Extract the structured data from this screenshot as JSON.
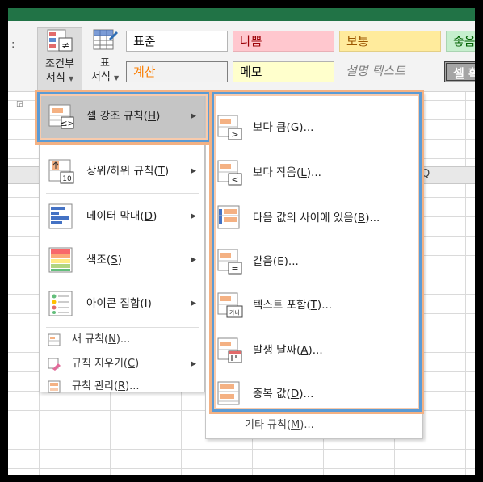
{
  "ribbon": {
    "left_fragment": ":",
    "conditional_format": {
      "label_line1": "조건부",
      "label_line2": "서식"
    },
    "format_table": {
      "label_line1": "표",
      "label_line2": "서식"
    },
    "cell_styles": {
      "normal": "표준",
      "bad": "나쁨",
      "neutral": "보통",
      "good": "좋음",
      "calculation": "계산",
      "note": "메모",
      "explanatory": "설명 텍스트",
      "check": "셀 확"
    }
  },
  "grid": {
    "column_label": "Q"
  },
  "main_menu": {
    "items": [
      {
        "label": "셀 강조 규칙(",
        "key": "H",
        "close": ")"
      },
      {
        "label": "상위/하위 규칙(",
        "key": "T",
        "close": ")"
      },
      {
        "label": "데이터 막대(",
        "key": "D",
        "close": ")"
      },
      {
        "label": "색조(",
        "key": "S",
        "close": ")"
      },
      {
        "label": "아이콘 집합(",
        "key": "I",
        "close": ")"
      }
    ],
    "small_items": [
      {
        "label": "새 규칙(",
        "key": "N",
        "close": ")..."
      },
      {
        "label": "규칙 지우기(",
        "key": "C",
        "close": ")"
      },
      {
        "label": "규칙 관리(",
        "key": "R",
        "close": ")..."
      }
    ]
  },
  "sub_menu": {
    "items": [
      {
        "label": "보다 큼(",
        "key": "G",
        "close": ")..."
      },
      {
        "label": "보다 작음(",
        "key": "L",
        "close": ")..."
      },
      {
        "label": "다음 값의 사이에 있음(",
        "key": "B",
        "close": ")..."
      },
      {
        "label": "같음(",
        "key": "E",
        "close": ")..."
      },
      {
        "label": "텍스트 포함(",
        "key": "T",
        "close": ")..."
      },
      {
        "label": "발생 날짜(",
        "key": "A",
        "close": ")..."
      },
      {
        "label": "중복 값(",
        "key": "D",
        "close": ")..."
      }
    ],
    "more": {
      "label": "기타 규칙(",
      "key": "M",
      "close": ")..."
    }
  },
  "colors": {
    "ribbon_green": "#217346",
    "highlight_blue": "#5b9bd5",
    "highlight_orange": "#f4b183"
  }
}
